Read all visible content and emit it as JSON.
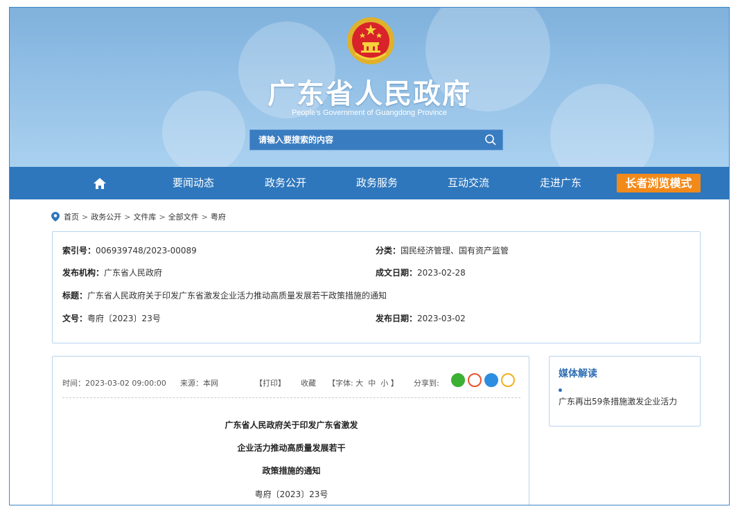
{
  "header": {
    "title": "广东省人民政府",
    "subtitle": "People's Government of Guangdong Province",
    "search_placeholder": "请输入要搜索的内容"
  },
  "nav": {
    "items": [
      "要闻动态",
      "政务公开",
      "政务服务",
      "互动交流",
      "走进广东"
    ],
    "elder_mode": "长者浏览模式"
  },
  "breadcrumb": [
    "首页",
    "政务公开",
    "文件库",
    "全部文件",
    "粤府"
  ],
  "breadcrumb_sep": ">",
  "info": {
    "index_label": "索引号：",
    "index_value": "006939748/2023-00089",
    "category_label": "分类：",
    "category_value": "国民经济管理、国有资产监管",
    "issuer_label": "发布机构：",
    "issuer_value": "广东省人民政府",
    "written_label": "成文日期：",
    "written_value": "2023-02-28",
    "title_label": "标题：",
    "title_value": "广东省人民政府关于印发广东省激发企业活力推动高质量发展若干政策措施的通知",
    "docno_label": "文号：",
    "docno_value": "粤府〔2023〕23号",
    "published_label": "发布日期：",
    "published_value": "2023-03-02"
  },
  "article": {
    "time": "时间：2023-03-02 09:00:00",
    "source": "来源：本网",
    "print": "【打印】",
    "favorite": "收藏",
    "font_label": "【字体:",
    "font_large": "大",
    "font_medium": "中",
    "font_small": "小",
    "font_close": "】",
    "share_label": "分享到:",
    "title_lines": [
      "广东省人民政府关于印发广东省激发",
      "企业活力推动高质量发展若干",
      "政策措施的通知"
    ],
    "doc_number": "粤府〔2023〕23号"
  },
  "side": {
    "heading": "媒体解读",
    "links": [
      "广东再出59条措施激发企业活力"
    ]
  },
  "colors": {
    "nav_bg": "#2e77bd",
    "elder_bg": "#f28a1a",
    "accent": "#2e6fb5",
    "share_wechat": "#3cb035",
    "share_weibo": "#e8532c",
    "share_qq": "#2d8ee0",
    "share_qzone": "#f2b01e"
  }
}
